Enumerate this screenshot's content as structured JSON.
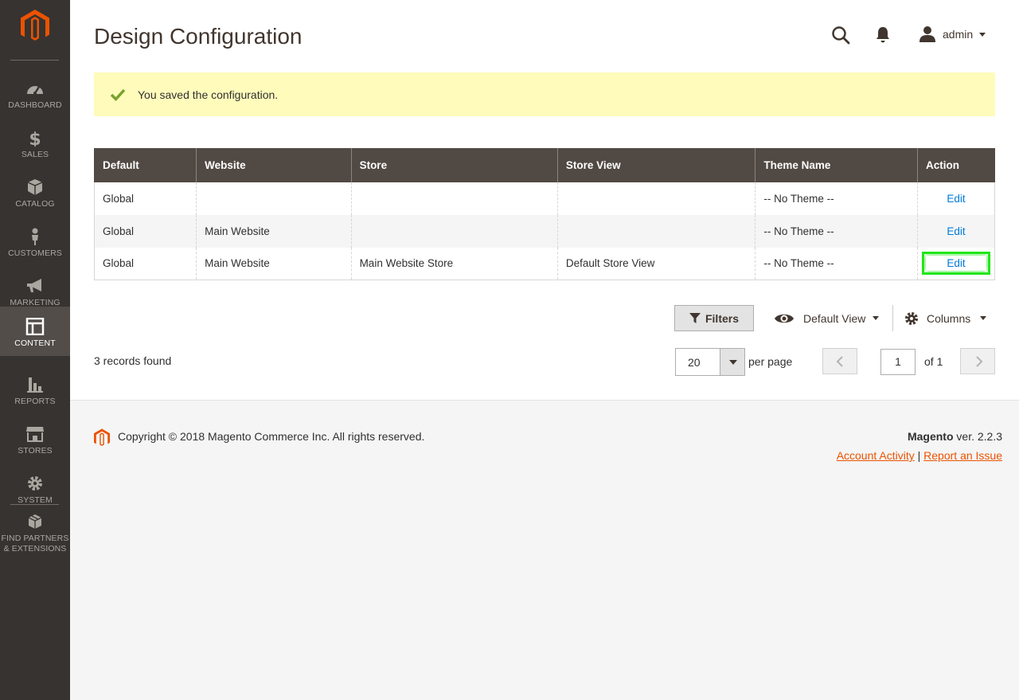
{
  "sidebar": {
    "items": [
      {
        "label": "DASHBOARD",
        "icon": "dashboard-icon"
      },
      {
        "label": "SALES",
        "icon": "dollar-icon"
      },
      {
        "label": "CATALOG",
        "icon": "box-icon"
      },
      {
        "label": "CUSTOMERS",
        "icon": "person-icon"
      },
      {
        "label": "MARKETING",
        "icon": "megaphone-icon"
      },
      {
        "label": "CONTENT",
        "icon": "layout-icon",
        "active": true
      },
      {
        "label": "REPORTS",
        "icon": "bar-chart-icon"
      },
      {
        "label": "STORES",
        "icon": "storefront-icon"
      },
      {
        "label": "SYSTEM",
        "icon": "gear-icon"
      },
      {
        "label_line1": "FIND PARTNERS",
        "label_line2": "& EXTENSIONS",
        "icon": "cubes-icon"
      }
    ]
  },
  "header": {
    "title": "Design Configuration",
    "user": "admin"
  },
  "message": {
    "text": "You saved the configuration."
  },
  "grid": {
    "columns": [
      "Default",
      "Website",
      "Store",
      "Store View",
      "Theme Name",
      "Action"
    ],
    "rows": [
      {
        "default": "Global",
        "website": "",
        "store": "",
        "store_view": "",
        "theme": "-- No Theme --",
        "action": "Edit"
      },
      {
        "default": "Global",
        "website": "Main Website",
        "store": "",
        "store_view": "",
        "theme": "-- No Theme --",
        "action": "Edit"
      },
      {
        "default": "Global",
        "website": "Main Website",
        "store": "Main Website Store",
        "store_view": "Default Store View",
        "theme": "-- No Theme --",
        "action": "Edit"
      }
    ]
  },
  "toolbar": {
    "filters_label": "Filters",
    "view_label": "Default View",
    "columns_label": "Columns",
    "records": "3 records found",
    "per_page_value": "20",
    "per_page_label": "per page",
    "page_value": "1",
    "page_of": "of 1"
  },
  "footer": {
    "copyright": "Copyright © 2018 Magento Commerce Inc. All rights reserved.",
    "brand": "Magento",
    "version": " ver. 2.2.3",
    "link_activity": "Account Activity",
    "separator": "|",
    "link_issue": "Report an Issue"
  },
  "colors": {
    "sidebar_bg": "#373330",
    "sidebar_active": "#524d49",
    "header_bg": "#514943",
    "link": "#007bdb",
    "brand_orange": "#eb5202",
    "message_bg": "#fffbbb",
    "success_check": "#79a22e",
    "highlight": "#22e61a"
  }
}
